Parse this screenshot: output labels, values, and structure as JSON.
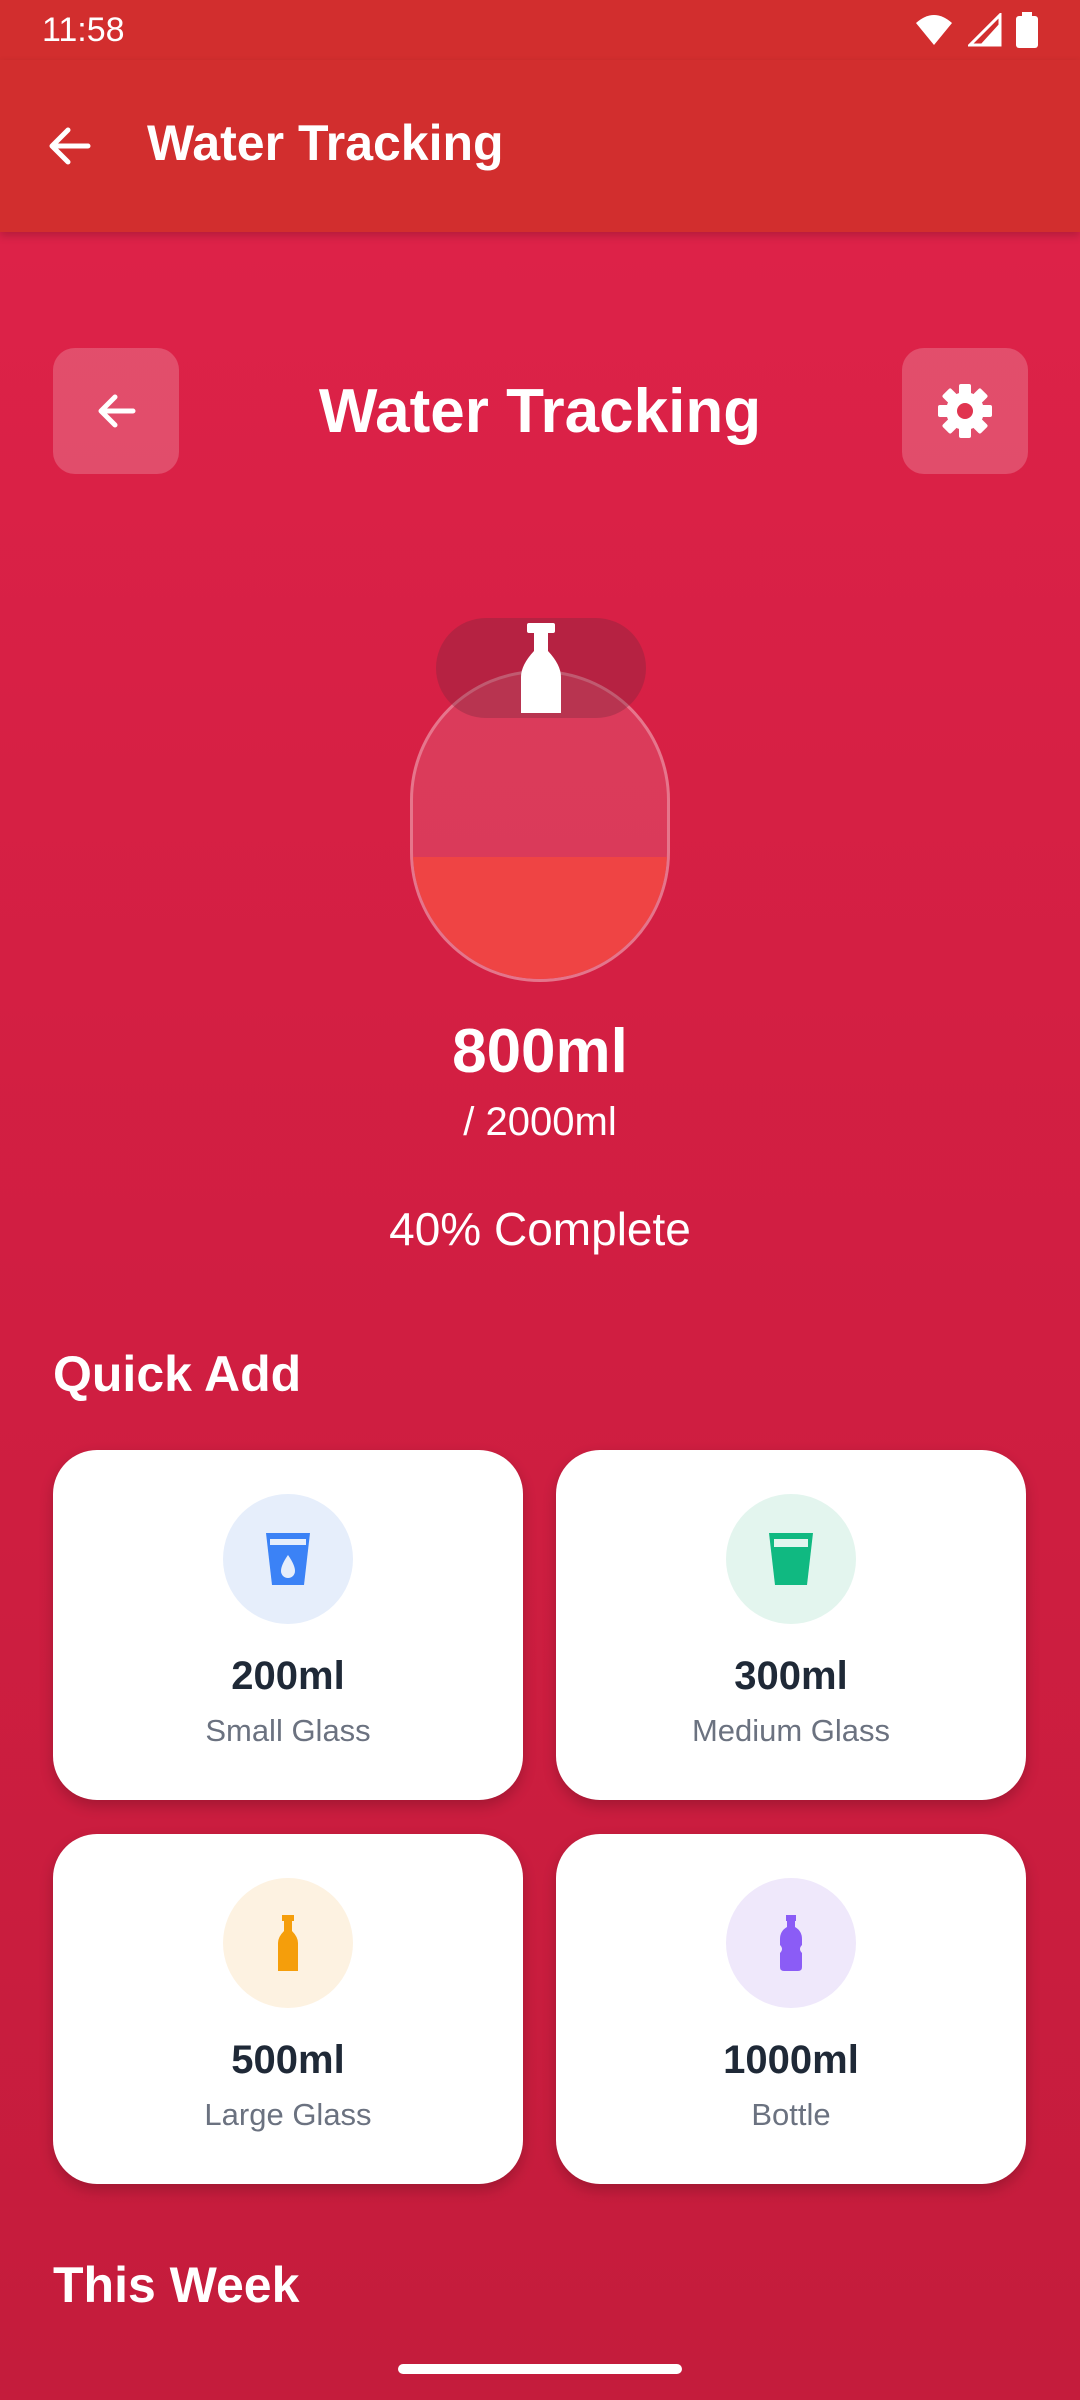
{
  "status_bar": {
    "time": "11:58"
  },
  "app_bar": {
    "title": "Water Tracking"
  },
  "header": {
    "title": "Water Tracking"
  },
  "progress": {
    "current": "800ml",
    "goal": "/ 2000ml",
    "percent_text": "40% Complete",
    "fraction": 0.4
  },
  "quick_add": {
    "title": "Quick Add",
    "items": [
      {
        "amount": "200ml",
        "label": "Small Glass",
        "icon": "glass-drop-icon",
        "color": "#3b82f6",
        "bg": "#e6eefb"
      },
      {
        "amount": "300ml",
        "label": "Medium Glass",
        "icon": "glass-icon",
        "color": "#10b981",
        "bg": "#e3f5ee"
      },
      {
        "amount": "500ml",
        "label": "Large Glass",
        "icon": "bottle-icon",
        "color": "#f59e0b",
        "bg": "#fdf2e1"
      },
      {
        "amount": "1000ml",
        "label": "Bottle",
        "icon": "water-bottle-icon",
        "color": "#8b5cf6",
        "bg": "#efe8fb"
      }
    ]
  },
  "week": {
    "title": "This Week"
  },
  "colors": {
    "app_bar": "#d22e2e",
    "accent_fill": "#ef4444",
    "background": "#d41f43"
  }
}
